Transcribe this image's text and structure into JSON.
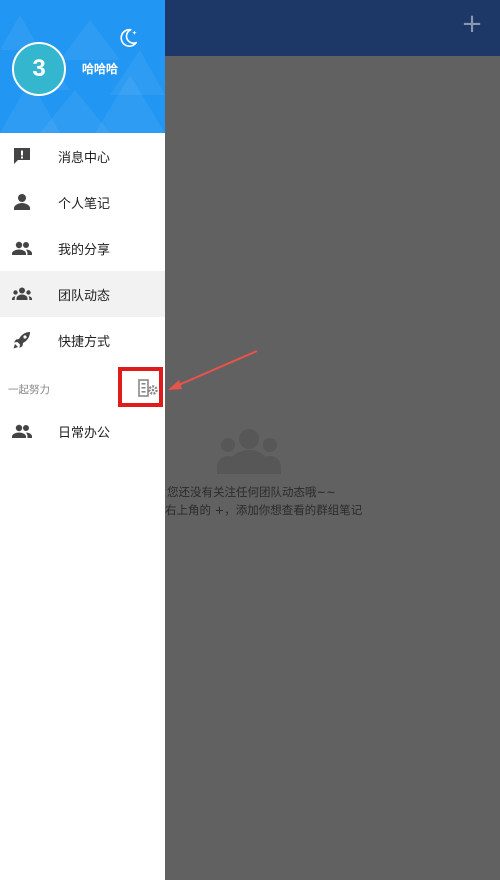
{
  "appbar": {
    "add_icon": "plus-icon"
  },
  "profile": {
    "avatar_text": "3",
    "username": "哈哈哈",
    "theme_icon": "moon-icon"
  },
  "menu": {
    "items": [
      {
        "label": "消息中心",
        "icon": "message-alert-icon",
        "active": false
      },
      {
        "label": "个人笔记",
        "icon": "person-icon",
        "active": false
      },
      {
        "label": "我的分享",
        "icon": "people-icon",
        "active": false
      },
      {
        "label": "团队动态",
        "icon": "group-icon",
        "active": true
      },
      {
        "label": "快捷方式",
        "icon": "rocket-icon",
        "active": false
      }
    ]
  },
  "team_section": {
    "label": "一起努力",
    "settings_icon": "team-settings-icon",
    "items": [
      {
        "label": "日常办公",
        "icon": "people-icon"
      }
    ]
  },
  "empty_state": {
    "icon": "group-icon",
    "line1": "您还没有关注任何团队动态哦~~",
    "line2": "右上角的 +，添加你想查看的群组笔记"
  },
  "colors": {
    "header_blue": "#2196f3",
    "appbar_navy": "#1d3767",
    "overlay_gray": "#616161",
    "avatar_teal": "#34b7ce",
    "annotation_red": "#e01b1b"
  }
}
